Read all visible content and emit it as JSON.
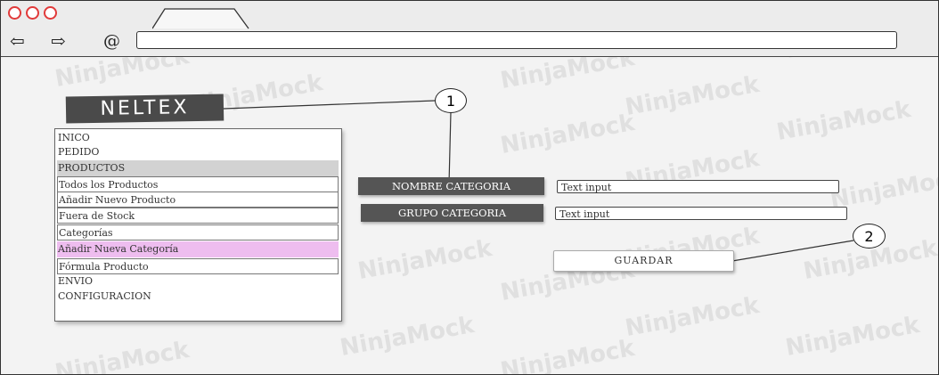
{
  "logo": {
    "text": "NELTEX"
  },
  "callouts": [
    "1",
    "2"
  ],
  "sidebar": {
    "items": [
      {
        "label": "INICO",
        "style": "plain"
      },
      {
        "label": "PEDIDO",
        "style": "plain"
      },
      {
        "label": "PRODUCTOS",
        "style": "header"
      },
      {
        "label": "Todos los Productos",
        "style": "boxed"
      },
      {
        "label": "Añadir Nuevo Producto",
        "style": "boxed"
      },
      {
        "label": "Fuera de Stock",
        "style": "boxed"
      },
      {
        "label": "Categorías",
        "style": "boxed"
      },
      {
        "label": "Añadir Nueva Categoría",
        "style": "active"
      },
      {
        "label": "Fórmula Producto",
        "style": "boxed"
      },
      {
        "label": "ENVIO",
        "style": "plain"
      },
      {
        "label": "CONFIGURACION",
        "style": "plain"
      }
    ]
  },
  "form": {
    "nombre_label": "NOMBRE CATEGORIA",
    "nombre_value": "Text input",
    "grupo_label": "GRUPO CATEGORIA",
    "grupo_value": "Text input",
    "save_label": "GUARDAR"
  },
  "watermark": "NinjaMock",
  "colors": {
    "traffic_light": "#e13a3a",
    "active_item": "#eebdef",
    "label_bg": "#555555",
    "logo_bg": "#4a4a4a"
  }
}
